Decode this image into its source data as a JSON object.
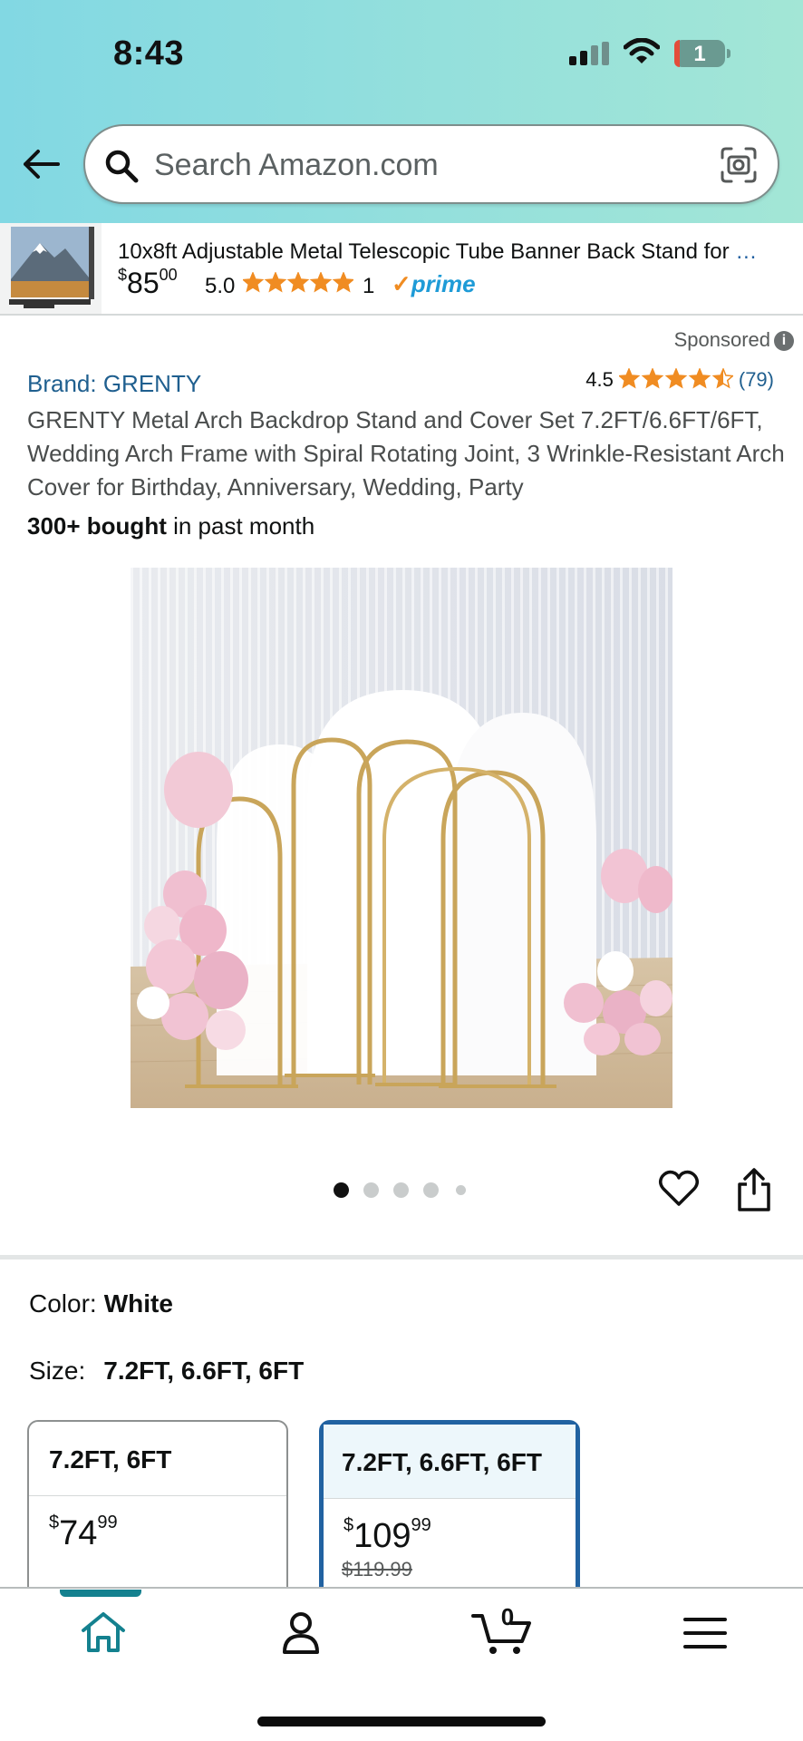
{
  "status_bar": {
    "time": "8:43",
    "battery_level": "1",
    "icons": [
      "cellular-signal-icon",
      "wifi-icon",
      "battery-icon"
    ]
  },
  "header": {
    "search_placeholder": "Search Amazon.com",
    "icons": [
      "back-arrow-icon",
      "search-icon",
      "camera-scan-icon"
    ]
  },
  "sponsored_ad": {
    "title": "10x8ft Adjustable Metal Telescopic Tube Banner Back Stand for ",
    "ellipsis": "…",
    "price_symbol": "$",
    "price_whole": "85",
    "price_fraction": "00",
    "rating": "5.0",
    "review_count": "1",
    "prime_check": "✓",
    "prime_label": "prime"
  },
  "product": {
    "sponsored_label": "Sponsored",
    "info_icon": "i",
    "brand": "Brand: GRENTY",
    "rating": "4.5",
    "rating_stars": 4.5,
    "review_count": "(79)",
    "title": "GRENTY Metal Arch Backdrop Stand and Cover Set 7.2FT/6.6FT/6FT, Wedding Arch Frame with Spiral Rotating Joint, 3 Wrinkle-Resistant Arch Cover for Birthday, Anniversary, Wedding, Party",
    "bought_bold": "300+ bought",
    "bought_rest": " in past month",
    "image_count": 5,
    "active_image": 1
  },
  "variations": {
    "color_label": "Color:",
    "color_value": "White",
    "size_label": "Size:",
    "size_value": "7.2FT, 6.6FT, 6FT",
    "options": [
      {
        "name": "7.2FT, 6FT",
        "price_symbol": "$",
        "price_whole": "74",
        "price_fraction": "99",
        "was_price": "",
        "selected": false
      },
      {
        "name": "7.2FT, 6.6FT, 6FT",
        "price_symbol": "$",
        "price_whole": "109",
        "price_fraction": "99",
        "was_price": "$119.99",
        "selected": true
      }
    ]
  },
  "bottom_nav": {
    "items": [
      "home-icon",
      "account-icon",
      "cart-icon",
      "menu-icon"
    ],
    "cart_count": "0",
    "active": "home"
  },
  "colors": {
    "header_gradient_start": "#82d8e3",
    "header_gradient_end": "#a3e6d6",
    "link_blue": "#1f5f8f",
    "star_orange": "#f08c22",
    "selected_border": "#2162a1",
    "nav_active": "#14818f"
  }
}
